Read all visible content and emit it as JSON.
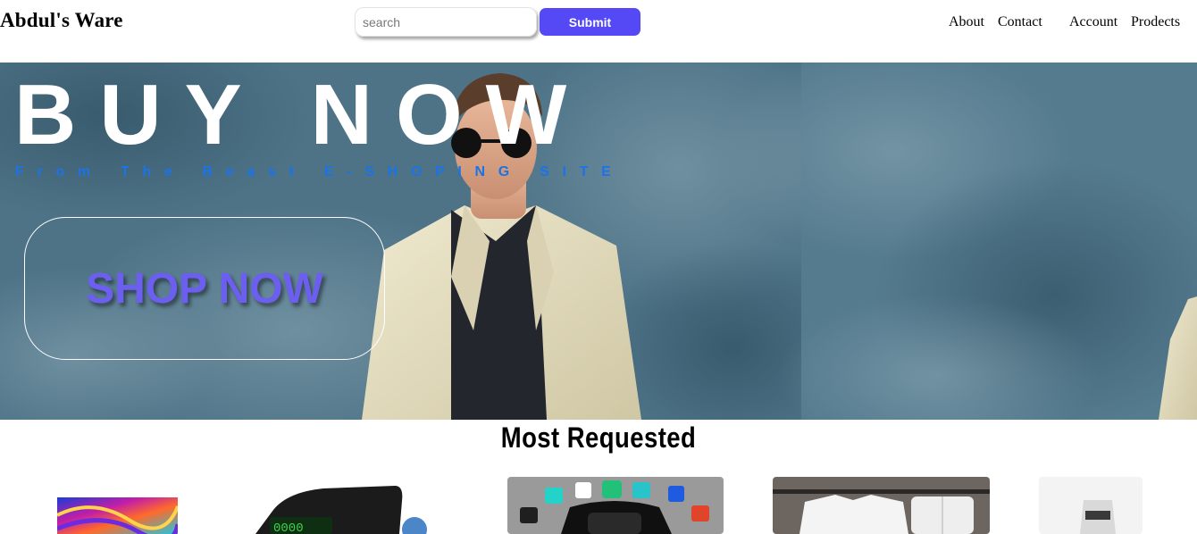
{
  "header": {
    "brand": "Abdul's Ware",
    "search": {
      "placeholder": "search",
      "value": ""
    },
    "submit_label": "Submit",
    "nav": [
      "About",
      "Contact",
      "Account",
      "Prodects"
    ]
  },
  "hero": {
    "title": "BUY NOW",
    "subtitle": "From The Beast E-SHOPING SITE",
    "cta_label": "SHOP NOW"
  },
  "most_requested": {
    "title": "Most Requested",
    "products": [
      {
        "name": "colorful-abstract-tablet"
      },
      {
        "name": "wireless-earbuds-powerbank"
      },
      {
        "name": "smartwatch"
      },
      {
        "name": "white-tshirt-shorts-set"
      },
      {
        "name": "kitchen-blender"
      }
    ]
  },
  "colors": {
    "accent": "#5449f5",
    "shop_label": "#6c5fef",
    "subtitle": "#1b73e8",
    "hero_bg": "#4f7284"
  }
}
